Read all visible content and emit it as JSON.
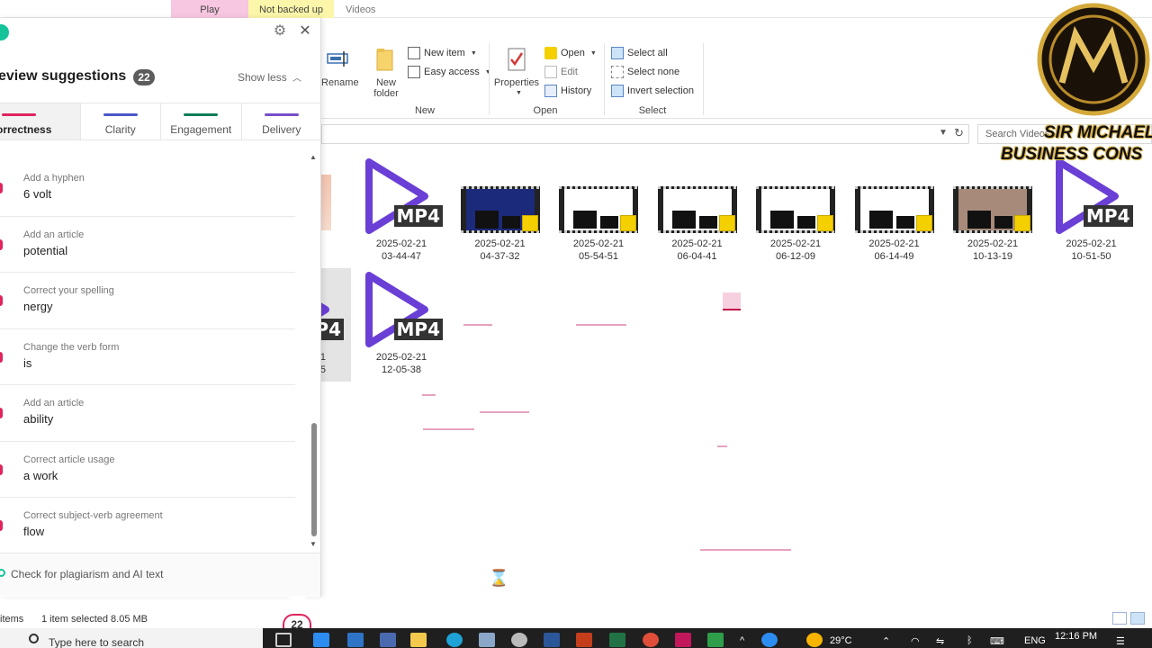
{
  "explorer": {
    "context_tabs": {
      "play": "Play",
      "not_backed_up": "Not backed up",
      "videos": "Videos"
    },
    "ribbon": {
      "rename_label": "Rename",
      "new_folder_label": "New\nfolder",
      "new_item_label": "New item",
      "easy_access_label": "Easy access",
      "new_group": "New",
      "properties_label": "Properties",
      "open_label": "Open",
      "edit_label": "Edit",
      "history_label": "History",
      "open_group": "Open",
      "select_all_label": "Select all",
      "select_none_label": "Select none",
      "invert_selection_label": "Invert selection",
      "select_group": "Select"
    },
    "search_placeholder": "Search Videos",
    "files_row1": [
      {
        "date": "2025-02-21",
        "time": "03-44-47",
        "kind": "mp4"
      },
      {
        "date": "2025-02-21",
        "time": "04-37-32",
        "kind": "film"
      },
      {
        "date": "2025-02-21",
        "time": "05-54-51",
        "kind": "film"
      },
      {
        "date": "2025-02-21",
        "time": "06-04-41",
        "kind": "film"
      },
      {
        "date": "2025-02-21",
        "time": "06-12-09",
        "kind": "film"
      },
      {
        "date": "2025-02-21",
        "time": "06-14-49",
        "kind": "film"
      },
      {
        "date": "2025-02-21",
        "time": "10-13-19",
        "kind": "film"
      },
      {
        "date": "2025-02-21",
        "time": "10-51-50",
        "kind": "mp4"
      }
    ],
    "files_row2": [
      {
        "date": "21",
        "time": "5",
        "kind": "mp4-partial"
      },
      {
        "date": "2025-02-21",
        "time": "12-05-38",
        "kind": "mp4"
      }
    ],
    "mp4_badge": "MP4",
    "status_items": "items",
    "status_selected": "1 item selected  8.05 MB"
  },
  "grammarly": {
    "title": "eview suggestions",
    "count": "22",
    "show_less": "Show less",
    "tabs": [
      {
        "label": "orrectness",
        "color": "#e0245e",
        "active": true
      },
      {
        "label": "Clarity",
        "color": "#4a56c6",
        "active": false
      },
      {
        "label": "Engagement",
        "color": "#0f7c5a",
        "active": false
      },
      {
        "label": "Delivery",
        "color": "#7a4fc9",
        "active": false
      }
    ],
    "suggestions": [
      {
        "category": "Add a hyphen",
        "text": "6 volt"
      },
      {
        "category": "Add an article",
        "text": "potential"
      },
      {
        "category": "Correct your spelling",
        "text": "nergy"
      },
      {
        "category": "Change the verb form",
        "text": "is"
      },
      {
        "category": "Add an article",
        "text": "ability"
      },
      {
        "category": "Correct article usage",
        "text": "a work"
      },
      {
        "category": "Correct subject-verb agreement",
        "text": "flow"
      }
    ],
    "footer": "Check for plagiarism and AI text",
    "bubble_count": "22"
  },
  "taskbar": {
    "search_placeholder": "Type here to search",
    "weather": "29°C",
    "language": "ENG",
    "time": "12:16 PM"
  },
  "watermark": {
    "line1": "SIR MICHAEL",
    "line2": "BUSINESS CONS"
  }
}
